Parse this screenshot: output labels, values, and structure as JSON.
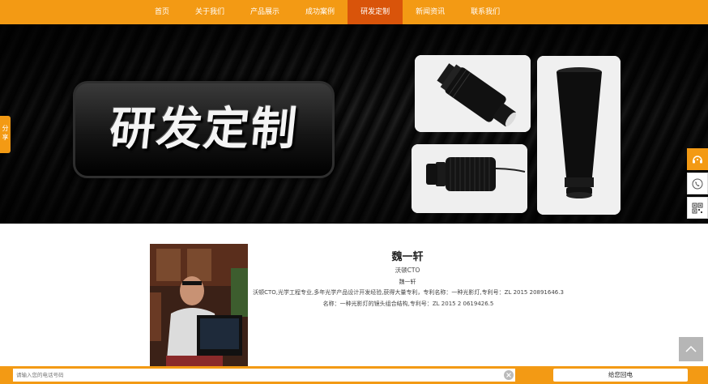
{
  "nav": {
    "items": [
      "首页",
      "关于我们",
      "产品展示",
      "成功案例",
      "研发定制",
      "新闻资讯",
      "联系我们"
    ],
    "active_index": 4,
    "color": "#f39a14",
    "active_color": "#d9540a"
  },
  "banner": {
    "title": "研发定制",
    "images": [
      "lens-assembly-photo",
      "projector-module-photo",
      "lens-tube-photo"
    ]
  },
  "profile": {
    "name": "魏一轩",
    "role": "沃顿CTO",
    "name_repeat": "魏一轩",
    "description_line1": "沃顿CTO,光学工程专业,多年光学产品设计开发经验,获得大量专利，专利名称：一种光影灯,专利号：ZL 2015 20891646.3",
    "description_line2": "名称：一种光影灯的镜头组合结构,专利号：ZL 2015 2 0619426.5"
  },
  "share": {
    "label": "分享"
  },
  "side_tools": [
    "headset-icon",
    "phone-icon",
    "qr-code-icon"
  ],
  "back_to_top": "arrow-up-icon",
  "bottom_bar": {
    "placeholder": "请输入您的电话号码",
    "button_label": "给您回电"
  }
}
